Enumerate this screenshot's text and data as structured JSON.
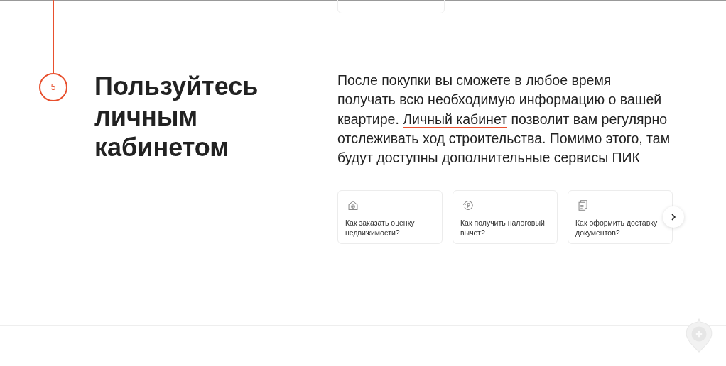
{
  "step": {
    "number": "5"
  },
  "heading": "Пользуйтесь личным кабинетом",
  "description": {
    "before": "После покупки вы сможете в любое время получать всю необходимую информацию о вашей квартире. ",
    "link": "Личный кабинет",
    "after": " позволит вам регулярно отслеживать ход строительства. Помимо этого, там будут доступны дополнительные сервисы ПИК"
  },
  "cards": [
    {
      "kind": "house",
      "title": "Как заказать оценку недвижимости?"
    },
    {
      "kind": "refund",
      "title": "Как получить налоговый вычет?"
    },
    {
      "kind": "documents",
      "title": "Как оформить доставку документов?"
    }
  ]
}
